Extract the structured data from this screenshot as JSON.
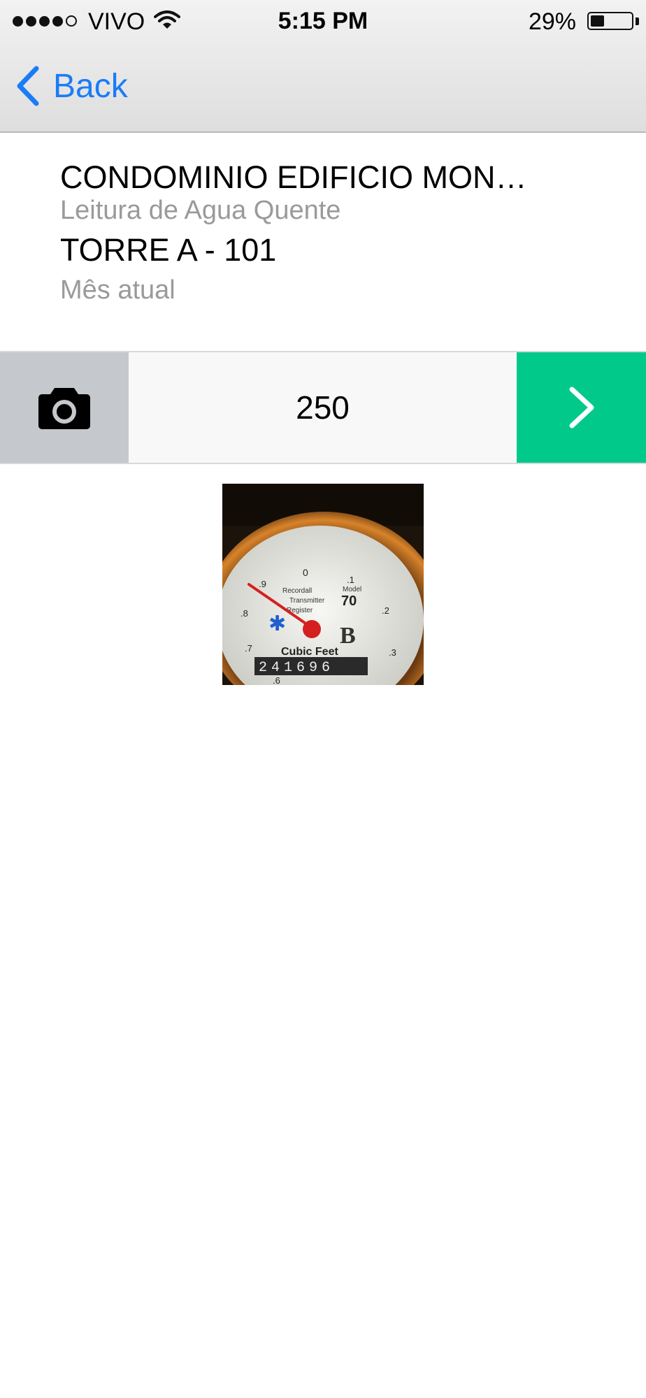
{
  "status_bar": {
    "carrier": "VIVO",
    "time": "5:15 PM",
    "battery": "29%",
    "battery_level": 0.29
  },
  "nav": {
    "back_label": "Back"
  },
  "info": {
    "condominium": "CONDOMINIO EDIFICIO MON…",
    "reading_type": "Leitura de Agua Quente",
    "unit": "TORRE A - 101",
    "period": "Mês atual"
  },
  "reading": {
    "value": "250"
  },
  "photo": {
    "meter_brand_line1": "Recordall",
    "meter_brand_line2": "Transmitter",
    "meter_brand_line3": "Register",
    "model_label": "Model",
    "model_number": "70",
    "unit_label": "Cubic Feet",
    "odometer": "241696"
  },
  "colors": {
    "accent_blue": "#1a7cf7",
    "next_green": "#00c98a",
    "camera_gray": "#c5c8cc",
    "secondary_text": "#9a9a9a"
  }
}
